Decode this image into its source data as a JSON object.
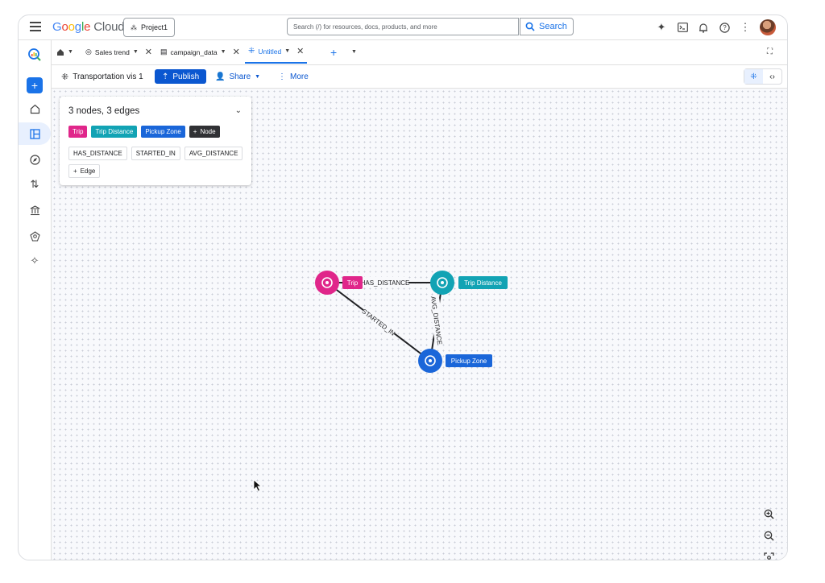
{
  "header": {
    "logo": "Google Cloud",
    "project": "Project1",
    "search_placeholder": "Search (/) for resources, docs, products, and more",
    "search_button": "Search"
  },
  "tabs": [
    {
      "label": "Sales trend"
    },
    {
      "label": "campaign_data"
    },
    {
      "label": "Untitled"
    }
  ],
  "toolbar": {
    "title": "Transportation vis 1",
    "publish": "Publish",
    "share": "Share",
    "more": "More"
  },
  "panel": {
    "title": "3 nodes, 3 edges",
    "node_chips": [
      {
        "label": "Trip",
        "color": "#e0268a"
      },
      {
        "label": "Trip Distance",
        "color": "#12a3b4"
      },
      {
        "label": "Pickup Zone",
        "color": "#1a66d9"
      }
    ],
    "add_node": "Node",
    "edge_chips": [
      "HAS_DISTANCE",
      "STARTED_IN",
      "AVG_DISTANCE"
    ],
    "add_edge": "Edge"
  },
  "graph": {
    "nodes": [
      {
        "label": "Trip",
        "color": "#e0268a"
      },
      {
        "label": "Trip Distance",
        "color": "#12a3b4"
      },
      {
        "label": "Pickup Zone",
        "color": "#1a66d9"
      }
    ],
    "edges": [
      "HAS_DISTANCE",
      "STARTED_IN",
      "AVG_DISTANCE"
    ]
  }
}
